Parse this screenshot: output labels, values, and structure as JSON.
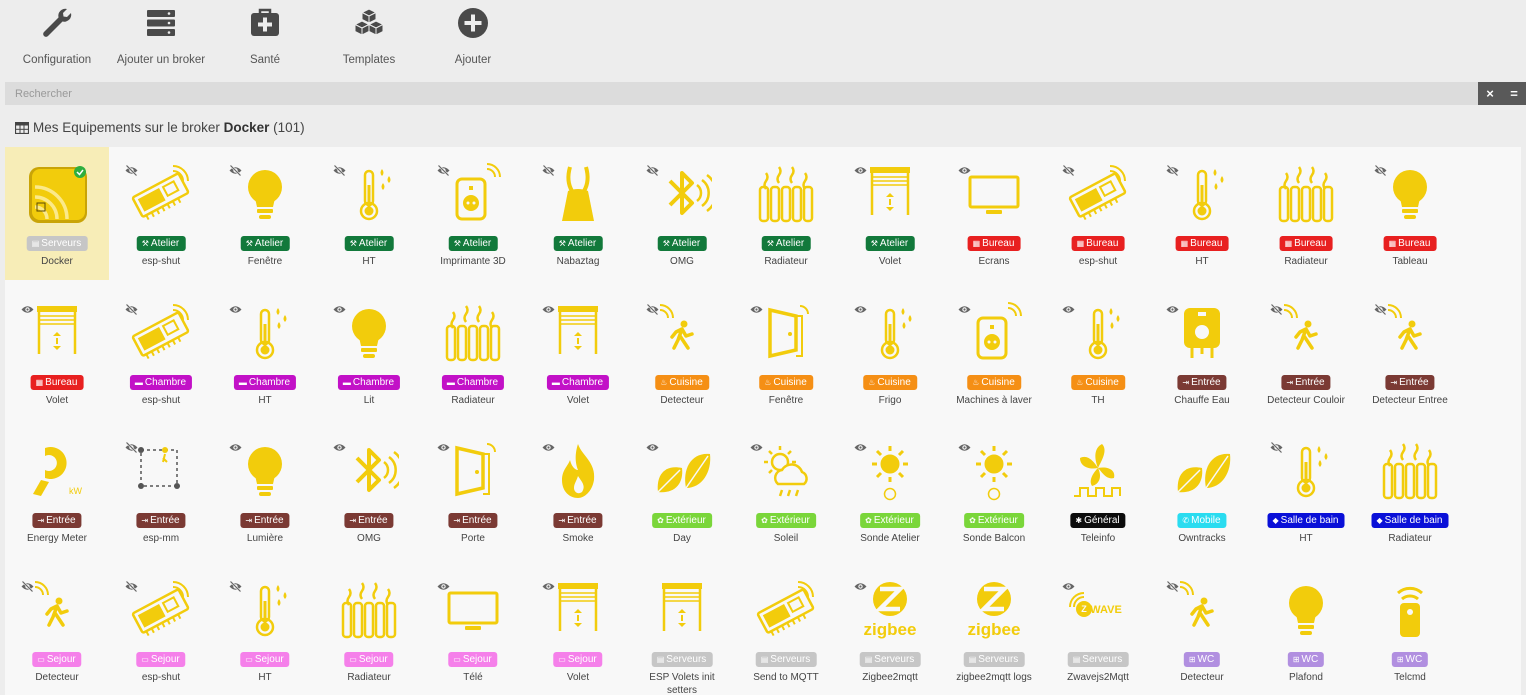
{
  "toolbar": [
    {
      "label": "Configuration",
      "icon": "wrench-icon"
    },
    {
      "label": "Ajouter un broker",
      "icon": "server-icon"
    },
    {
      "label": "Santé",
      "icon": "medkit-icon"
    },
    {
      "label": "Templates",
      "icon": "cubes-icon"
    },
    {
      "label": "Ajouter",
      "icon": "plus-circle-icon"
    }
  ],
  "search": {
    "placeholder": "Rechercher",
    "clear_label": "×",
    "menu_label": "="
  },
  "heading": {
    "prefix": "Mes Equipements sur le broker",
    "broker": "Docker",
    "count": "(101)"
  },
  "colors": {
    "icon_yellow": "#f2cc0c",
    "Serveurs": "#c6c6c6",
    "Atelier": "#12793b",
    "Bureau": "#e82020",
    "Chambre": "#c211c7",
    "Cuisine": "#f58f15",
    "Entrée": "#7b3a34",
    "Extérieur": "#7ad63a",
    "Général": "#0c0c0c",
    "Mobile": "#2adcf0",
    "Salle de bain": "#0a10d8",
    "Sejour": "#f580ea",
    "WC": "#b18fe0"
  },
  "equipments": [
    {
      "name": "Docker",
      "zone": "Serveurs",
      "icon": "rss-app-icon",
      "selected": true,
      "status": ""
    },
    {
      "name": "esp-shut",
      "zone": "Atelier",
      "icon": "esp-board-icon",
      "status": "hidden"
    },
    {
      "name": "Fenêtre",
      "zone": "Atelier",
      "icon": "bulb-icon",
      "status": "hidden"
    },
    {
      "name": "HT",
      "zone": "Atelier",
      "icon": "thermometer-icon",
      "status": "hidden"
    },
    {
      "name": "Imprimante 3D",
      "zone": "Atelier",
      "icon": "plug-icon",
      "status": "hidden"
    },
    {
      "name": "Nabaztag",
      "zone": "Atelier",
      "icon": "rabbit-icon",
      "status": "hidden"
    },
    {
      "name": "OMG",
      "zone": "Atelier",
      "icon": "bluetooth-icon",
      "status": "hidden"
    },
    {
      "name": "Radiateur",
      "zone": "Atelier",
      "icon": "radiator-icon",
      "status": ""
    },
    {
      "name": "Volet",
      "zone": "Atelier",
      "icon": "shutter-icon",
      "status": "visible"
    },
    {
      "name": "Ecrans",
      "zone": "Bureau",
      "icon": "monitor-icon",
      "status": "visible"
    },
    {
      "name": "esp-shut",
      "zone": "Bureau",
      "icon": "esp-board-icon",
      "status": "hidden"
    },
    {
      "name": "HT",
      "zone": "Bureau",
      "icon": "thermometer-icon",
      "status": "hidden"
    },
    {
      "name": "Radiateur",
      "zone": "Bureau",
      "icon": "radiator-icon",
      "status": ""
    },
    {
      "name": "Tableau",
      "zone": "Bureau",
      "icon": "bulb-icon",
      "status": "hidden"
    },
    {
      "name": "Volet",
      "zone": "Bureau",
      "icon": "shutter-icon",
      "status": "visible"
    },
    {
      "name": "esp-shut",
      "zone": "Chambre",
      "icon": "esp-board-icon",
      "status": "hidden"
    },
    {
      "name": "HT",
      "zone": "Chambre",
      "icon": "thermometer-icon",
      "status": "visible"
    },
    {
      "name": "Lit",
      "zone": "Chambre",
      "icon": "bulb-icon",
      "status": "visible"
    },
    {
      "name": "Radiateur",
      "zone": "Chambre",
      "icon": "radiator-icon",
      "status": ""
    },
    {
      "name": "Volet",
      "zone": "Chambre",
      "icon": "shutter-icon",
      "status": "visible"
    },
    {
      "name": "Detecteur",
      "zone": "Cuisine",
      "icon": "motion-icon",
      "status": "hidden"
    },
    {
      "name": "Fenêtre",
      "zone": "Cuisine",
      "icon": "door-icon",
      "status": "visible"
    },
    {
      "name": "Frigo",
      "zone": "Cuisine",
      "icon": "thermometer-icon",
      "status": "visible"
    },
    {
      "name": "Machines à laver",
      "zone": "Cuisine",
      "icon": "plug-icon",
      "status": "visible"
    },
    {
      "name": "TH",
      "zone": "Cuisine",
      "icon": "thermometer-icon",
      "status": "visible"
    },
    {
      "name": "Chauffe Eau",
      "zone": "Entrée",
      "icon": "boiler-icon",
      "status": "visible"
    },
    {
      "name": "Detecteur Couloir",
      "zone": "Entrée",
      "icon": "motion-icon",
      "status": "hidden"
    },
    {
      "name": "Detecteur Entree",
      "zone": "Entrée",
      "icon": "motion-icon",
      "status": "hidden"
    },
    {
      "name": "Energy Meter",
      "zone": "Entrée",
      "icon": "clamp-icon",
      "status": ""
    },
    {
      "name": "esp-mm",
      "zone": "Entrée",
      "icon": "mmwave-icon",
      "status": "hidden"
    },
    {
      "name": "Lumière",
      "zone": "Entrée",
      "icon": "bulb-icon",
      "status": "visible"
    },
    {
      "name": "OMG",
      "zone": "Entrée",
      "icon": "bluetooth-icon",
      "status": "visible"
    },
    {
      "name": "Porte",
      "zone": "Entrée",
      "icon": "door-icon",
      "status": "visible"
    },
    {
      "name": "Smoke",
      "zone": "Entrée",
      "icon": "flame-icon",
      "status": "visible"
    },
    {
      "name": "Day",
      "zone": "Extérieur",
      "icon": "leaves-icon",
      "status": "visible"
    },
    {
      "name": "Soleil",
      "zone": "Extérieur",
      "icon": "weather-icon",
      "status": "visible"
    },
    {
      "name": "Sonde Atelier",
      "zone": "Extérieur",
      "icon": "sun-sensor-icon",
      "status": "visible"
    },
    {
      "name": "Sonde Balcon",
      "zone": "Extérieur",
      "icon": "sun-sensor-icon",
      "status": "visible"
    },
    {
      "name": "Teleinfo",
      "zone": "Général",
      "icon": "fan-signal-icon",
      "status": ""
    },
    {
      "name": "Owntracks",
      "zone": "Mobile",
      "icon": "leaves-icon",
      "status": ""
    },
    {
      "name": "HT",
      "zone": "Salle de bain",
      "icon": "thermometer-icon",
      "status": "hidden"
    },
    {
      "name": "Radiateur",
      "zone": "Salle de bain",
      "icon": "radiator-icon",
      "status": ""
    },
    {
      "name": "Detecteur",
      "zone": "Sejour",
      "icon": "motion-icon",
      "status": "hidden"
    },
    {
      "name": "esp-shut",
      "zone": "Sejour",
      "icon": "esp-board-icon",
      "status": "hidden"
    },
    {
      "name": "HT",
      "zone": "Sejour",
      "icon": "thermometer-icon",
      "status": "hidden"
    },
    {
      "name": "Radiateur",
      "zone": "Sejour",
      "icon": "radiator-icon",
      "status": ""
    },
    {
      "name": "Télé",
      "zone": "Sejour",
      "icon": "monitor-icon",
      "status": "visible"
    },
    {
      "name": "Volet",
      "zone": "Sejour",
      "icon": "shutter-icon",
      "status": "visible"
    },
    {
      "name": "ESP Volets init setters",
      "zone": "Serveurs",
      "icon": "shutter-icon",
      "status": ""
    },
    {
      "name": "Send to MQTT",
      "zone": "Serveurs",
      "icon": "esp-board-icon",
      "status": ""
    },
    {
      "name": "Zigbee2mqtt",
      "zone": "Serveurs",
      "icon": "zigbee-icon",
      "status": "visible"
    },
    {
      "name": "zigbee2mqtt logs",
      "zone": "Serveurs",
      "icon": "zigbee-icon",
      "status": ""
    },
    {
      "name": "Zwavejs2Mqtt",
      "zone": "Serveurs",
      "icon": "zwave-icon",
      "status": "visible"
    },
    {
      "name": "Detecteur",
      "zone": "WC",
      "icon": "motion-icon",
      "status": "hidden"
    },
    {
      "name": "Plafond",
      "zone": "WC",
      "icon": "bulb-icon",
      "status": ""
    },
    {
      "name": "Telcmd",
      "zone": "WC",
      "icon": "remote-icon",
      "status": ""
    }
  ]
}
